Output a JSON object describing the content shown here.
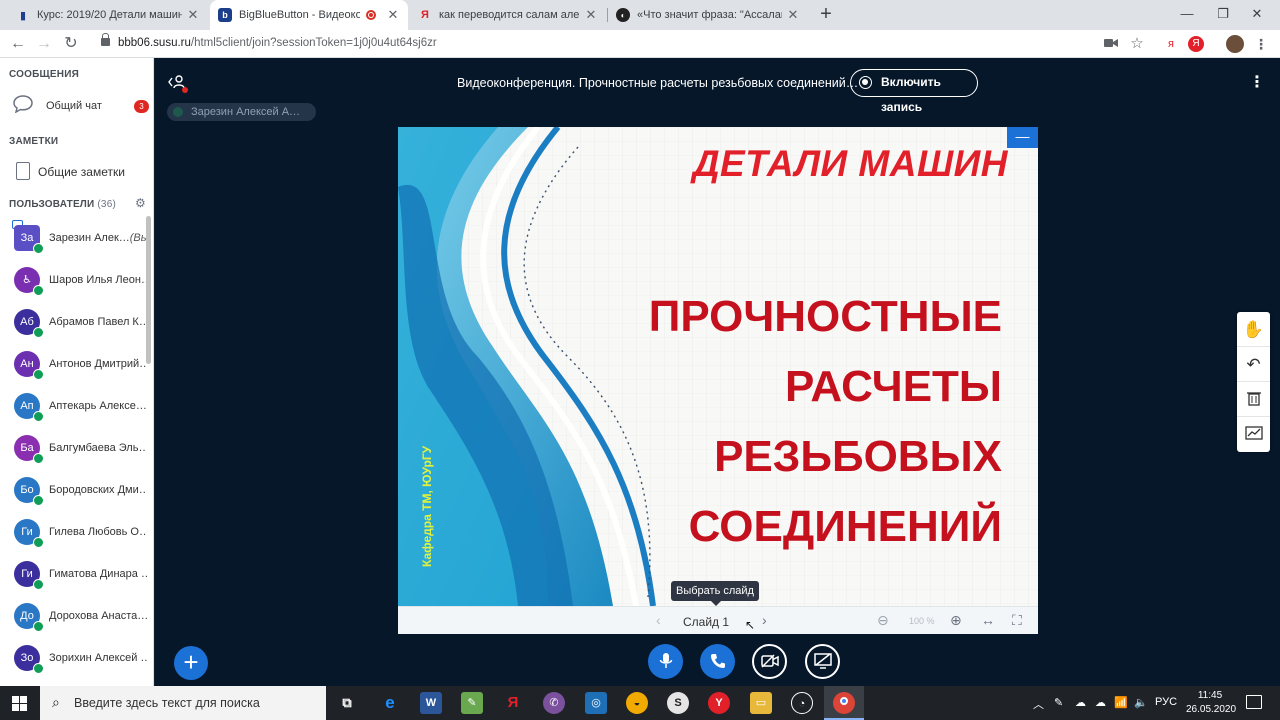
{
  "browser": {
    "tabs": [
      {
        "title": "Курс: 2019/20 Детали машин (Ук",
        "icon": "book-icon"
      },
      {
        "title": "BigBlueButton - Видеоконф",
        "icon": "bigbluebutton-icon",
        "recording": true
      },
      {
        "title": "как переводится салам алейкум",
        "icon": "yandex-icon"
      },
      {
        "title": "«Что значит фраза: \"Ассалам ал",
        "icon": "otvet-icon"
      }
    ],
    "new_tab": "+",
    "url_host": "bbb06.susu.ru",
    "url_path": "/html5client/join?sessionToken=1j0j0u4ut64sj6zr"
  },
  "sidebar": {
    "messages_title": "СООБЩЕНИЯ",
    "public_chat": "Общий чат",
    "public_chat_unread": "3",
    "notes_title": "ЗАМЕТКИ",
    "shared_notes": "Общие заметки",
    "users_title": "ПОЛЬЗОВАТЕЛИ",
    "users_count": "(36)",
    "you_suffix": "(Вы)",
    "users": [
      {
        "initials": "За",
        "name": "Зарезин Алек…",
        "color": "#5b4fc6",
        "square": true,
        "presenter": true,
        "you": true
      },
      {
        "initials": "",
        "name": "Шаров Илья Леон…",
        "color": "#7a2fb0",
        "avatar_icon": "accessibility-icon"
      },
      {
        "initials": "Аб",
        "name": "Абрамов Павел К…",
        "color": "#3b2f9e"
      },
      {
        "initials": "Ан",
        "name": "Антонов Дмитрий…",
        "color": "#6b2fb0"
      },
      {
        "initials": "Ап",
        "name": "Аптекарь Алексе…",
        "color": "#2a78c5"
      },
      {
        "initials": "Ба",
        "name": "Балгумбаева Эль…",
        "color": "#8a2fb0"
      },
      {
        "initials": "Бо",
        "name": "Бородовских Дми…",
        "color": "#2a78c5"
      },
      {
        "initials": "Ги",
        "name": "Гилева Любовь О…",
        "color": "#2a78c5"
      },
      {
        "initials": "Ги",
        "name": "Гиматова Динара …",
        "color": "#3b2f9e"
      },
      {
        "initials": "До",
        "name": "Дорохова Анаста…",
        "color": "#2a78c5"
      },
      {
        "initials": "Зо",
        "name": "Зорихин Алексей …",
        "color": "#3b2f9e"
      }
    ]
  },
  "main": {
    "meeting_title": "Видеоконференция. Прочностные расчеты резьбовых соединений…",
    "record_button": "Включить запись",
    "talking_indicator": "Зарезин Алексей А…",
    "slide": {
      "title_top": "ДЕТАЛИ МАШИН",
      "title_lines": [
        "ПРОЧНОСТНЫЕ",
        "РАСЧЕТЫ",
        "РЕЗЬБОВЫХ",
        "СОЕДИНЕНИЙ"
      ],
      "department": "Кафедра ТМ, ЮУрГУ"
    },
    "slide_label": "Слайд 1",
    "zoom_level": "100 %",
    "tooltip": "Выбрать слайд"
  },
  "taskbar": {
    "search_placeholder": "Введите здесь текст для поиска",
    "language": "РУС",
    "time": "11:45",
    "date": "26.05.2020"
  }
}
